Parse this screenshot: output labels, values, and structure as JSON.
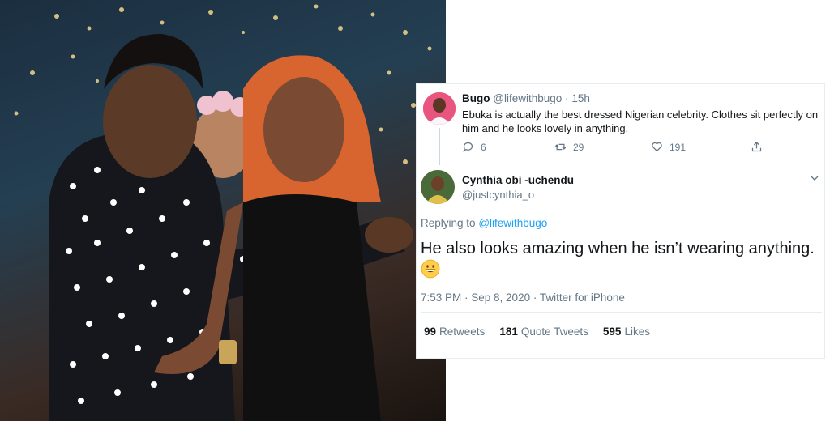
{
  "parent_tweet": {
    "name": "Bugo",
    "handle": "@lifewithbugo",
    "separator": "·",
    "time": "15h",
    "text": "Ebuka is actually the best dressed Nigerian celebrity. Clothes sit perfectly on him and he looks lovely in anything.",
    "reply_count": "6",
    "retweet_count": "29",
    "like_count": "191"
  },
  "main_tweet": {
    "name": "Cynthia obi -uchendu",
    "handle": "@justcynthia_o",
    "replying_prefix": "Replying to",
    "replying_to": "@lifewithbugo",
    "text": "He also looks amazing when he isn’t wearing anything.",
    "emoji_icon": "grinning-face-emoji",
    "timestamp": "7:53 PM · Sep 8, 2020 · Twitter for iPhone",
    "retweets_count": "99",
    "retweets_label": "Retweets",
    "quote_count": "181",
    "quote_label": "Quote Tweets",
    "likes_count": "595",
    "likes_label": "Likes"
  },
  "colors": {
    "link": "#1da1f2",
    "secondary_text": "#657786",
    "border": "#e6ecf0"
  }
}
